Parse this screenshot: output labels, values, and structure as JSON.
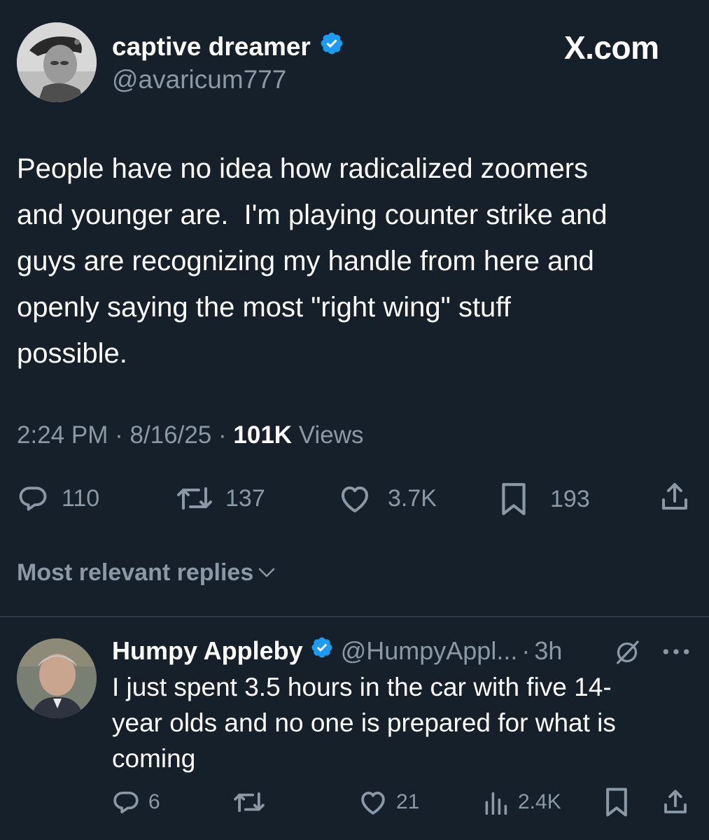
{
  "tweet": {
    "author": {
      "display_name": "captive dreamer",
      "handle": "@avaricum777",
      "verified": true
    },
    "brand_text": "X.com",
    "text": "People have no idea how radicalized zoomers\nand younger are.  I'm playing counter strike and\nguys are recognizing my handle from here and\nopenly saying the most \"right wing\" stuff\npossible.",
    "time": "2:24 PM",
    "date": "8/16/25",
    "dot": "·",
    "views_count": "101K",
    "views_label": "Views",
    "stats": {
      "replies": "110",
      "reposts": "137",
      "likes": "3.7K",
      "bookmarks": "193"
    }
  },
  "replies_sort_label": "Most relevant replies",
  "reply": {
    "display_name": "Humpy Appleby",
    "handle": "@HumpyAppl...",
    "dot": "·",
    "time": "3h",
    "verified": true,
    "text": "I just spent 3.5 hours in the car with five 14-\nyear olds and no one is prepared for what is\ncoming",
    "stats": {
      "replies": "6",
      "likes": "21",
      "views": "2.4K"
    }
  },
  "colors": {
    "background": "#15202b",
    "text": "#ffffff",
    "secondary": "#8b98a5",
    "verified": "#1d9bf0",
    "divider": "#2f3b47"
  },
  "icons": [
    "verified-badge-icon",
    "reply-icon",
    "repost-icon",
    "like-icon",
    "bookmark-icon",
    "share-icon",
    "chevron-down-icon",
    "views-icon",
    "grok-icon",
    "more-icon"
  ]
}
